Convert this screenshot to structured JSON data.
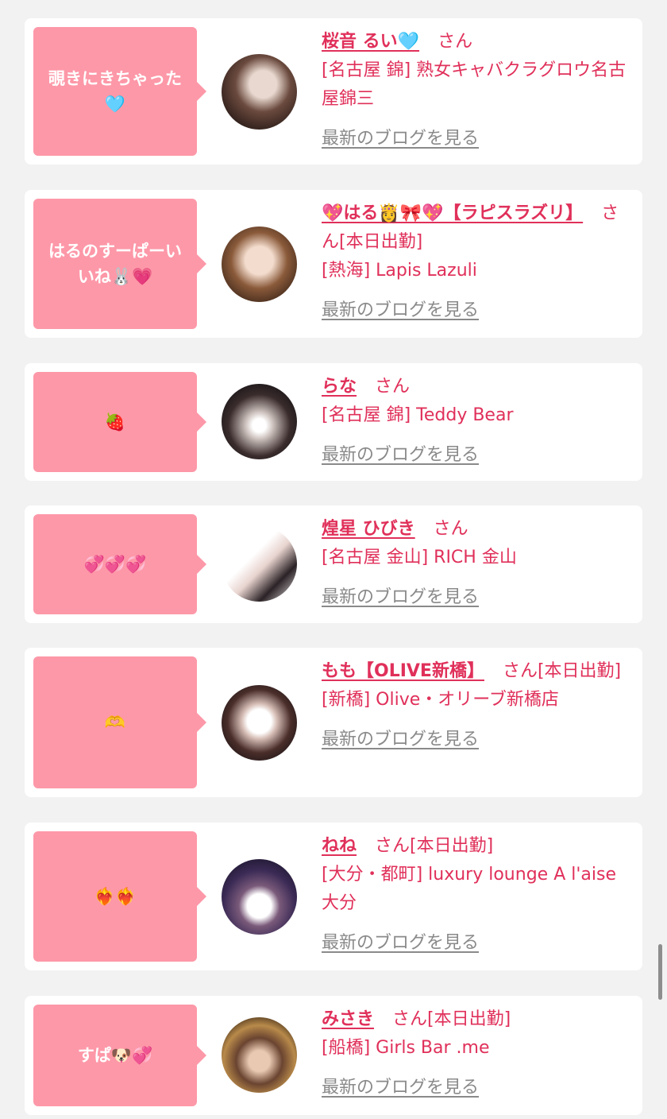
{
  "cards": [
    {
      "bubble": "覗きにきちゃった🩵",
      "name": "桜音 るい🩵",
      "suffix": "さん",
      "shop": "[名古屋 錦] 熟女キャバクラグロウ名古屋錦三",
      "blog": "最新のブログを見る",
      "avatar_colors": [
        "#d9c8bd",
        "#3a2a24"
      ]
    },
    {
      "bubble": "はるのすーぱーいいね🐰💗",
      "name": "💖はる👸🎀💖【ラピスラズリ】",
      "suffix": "さん[本日出勤]",
      "shop": "[熱海] Lapis Lazuli",
      "blog": "最新のブログを見る",
      "avatar_colors": [
        "#f1d6c8",
        "#5a3a28"
      ]
    },
    {
      "bubble": "🍓",
      "name": "らな",
      "suffix": "さん",
      "shop": "[名古屋 錦] Teddy Bear",
      "blog": "最新のブログを見る",
      "avatar_colors": [
        "#ffffff",
        "#1e1a1c"
      ]
    },
    {
      "bubble": "💞💞💞",
      "name": "煌星 ひびき",
      "suffix": "さん",
      "shop": "[名古屋 金山] RICH 金山",
      "blog": "最新のブログを見る",
      "avatar_colors": [
        "#ffffff",
        "#c9a5a8"
      ]
    },
    {
      "bubble": "🫶",
      "name": "もも【OLIVE新橋】",
      "suffix": "さん[本日出勤]",
      "shop": "[新橋] Olive・オリーブ新橋店",
      "blog": "最新のブログを見る",
      "avatar_colors": [
        "#f5f5f5",
        "#2d1f22"
      ]
    },
    {
      "bubble": "❤️‍🔥❤️‍🔥",
      "name": "ねね",
      "suffix": "さん[本日出勤]",
      "shop": "[大分・都町] luxury lounge A l'aise 大分",
      "blog": "最新のブログを見る",
      "avatar_colors": [
        "#ffffff",
        "#2a2040"
      ]
    },
    {
      "bubble": "すぱ🐶💞",
      "name": "みさき",
      "suffix": "さん[本日出勤]",
      "shop": "[船橋] Girls Bar .me",
      "blog": "最新のブログを見る",
      "avatar_colors": [
        "#c99a5a",
        "#2a1a10"
      ]
    }
  ],
  "accent_color": "#e0305a",
  "bubble_color": "#fd98a8"
}
